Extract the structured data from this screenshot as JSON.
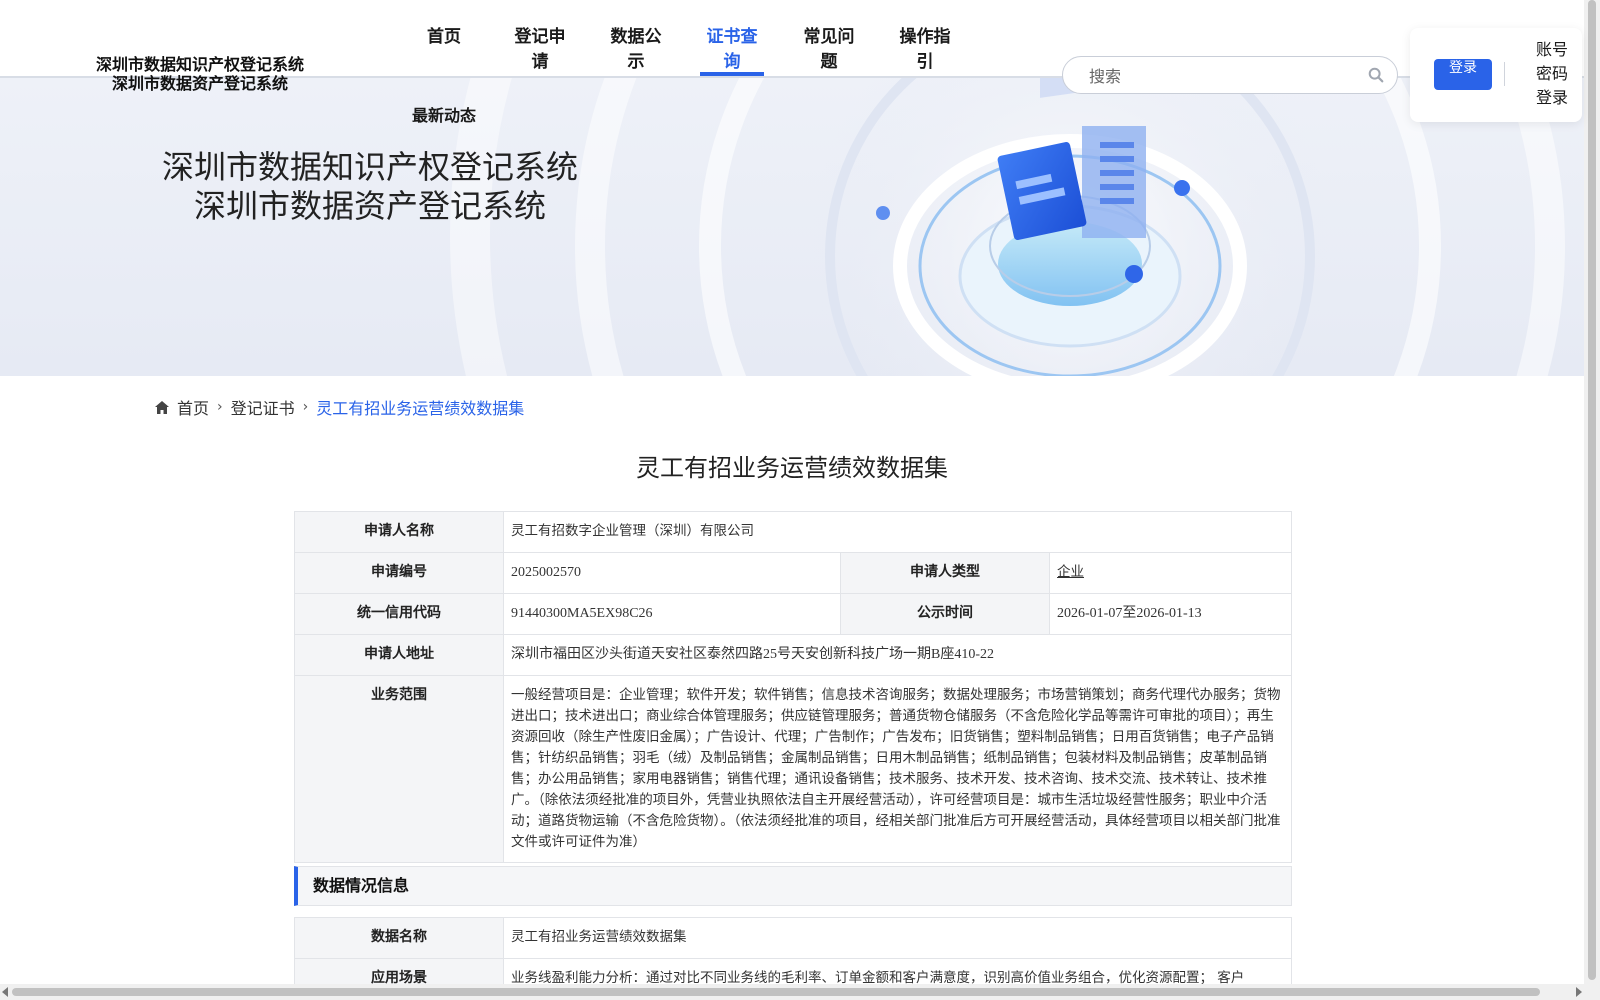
{
  "header": {
    "brand_line1": "深圳市数据知识产权登记系统",
    "brand_line2": "深圳市数据资产登记系统",
    "nav": [
      {
        "label": "首页",
        "active": false
      },
      {
        "label": "登记申请",
        "active": false
      },
      {
        "label": "数据公示",
        "active": false
      },
      {
        "label": "证书查询",
        "active": true
      },
      {
        "label": "常见问题",
        "active": false
      },
      {
        "label": "操作指引",
        "active": false
      }
    ],
    "nav_extra": "最新动态",
    "search_placeholder": "搜索",
    "search_icon": "search-icon",
    "login_button": "登录",
    "account_links": [
      "账号",
      "密码",
      "登录"
    ],
    "accent_color": "#2a63e8"
  },
  "banner": {
    "title_line1": "深圳市数据知识产权登记系统",
    "title_line2": "深圳市数据资产登记系统"
  },
  "breadcrumb": {
    "home_icon": "home-icon",
    "home": "首页",
    "level2": "登记证书",
    "current": "灵工有招业务运营绩效数据集"
  },
  "page_title": "灵工有招业务运营绩效数据集",
  "applicant": {
    "name_label": "申请人名称",
    "name_value": "灵工有招数字企业管理（深圳）有限公司",
    "app_no_label": "申请编号",
    "app_no_value": "2025002570",
    "type_label": "申请人类型",
    "type_value": "企业",
    "credit_label": "统一信用代码",
    "credit_value": "91440300MA5EX98C26",
    "period_label": "公示时间",
    "period_value": "2026-01-07至2026-01-13",
    "address_label": "申请人地址",
    "address_value": "深圳市福田区沙头街道天安社区泰然四路25号天安创新科技广场一期B座410-22",
    "scope_label": "业务范围",
    "scope_value": "一般经营项目是：企业管理；软件开发；软件销售；信息技术咨询服务；数据处理服务；市场营销策划；商务代理代办服务；货物进出口；技术进出口；商业综合体管理服务；供应链管理服务；普通货物仓储服务（不含危险化学品等需许可审批的项目）；再生资源回收（除生产性废旧金属）；广告设计、代理；广告制作；广告发布；旧货销售；塑料制品销售；日用百货销售；电子产品销售；针纺织品销售；羽毛（绒）及制品销售；金属制品销售；日用木制品销售；纸制品销售；包装材料及制品销售；皮革制品销售；办公用品销售；家用电器销售；销售代理；通讯设备销售；技术服务、技术开发、技术咨询、技术交流、技术转让、技术推广。（除依法须经批准的项目外，凭营业执照依法自主开展经营活动），许可经营项目是：城市生活垃圾经营性服务；职业中介活动；道路货物运输（不含危险货物）。（依法须经批准的项目，经相关部门批准后方可开展经营活动，具体经营项目以相关部门批准文件或许可证件为准）"
  },
  "data_section": {
    "heading": "数据情况信息",
    "name_label": "数据名称",
    "name_value": "灵工有招业务运营绩效数据集",
    "scene_label": "应用场景",
    "scene_value": "业务线盈利能力分析：通过对比不同业务线的毛利率、订单金额和客户满意度，识别高价值业务组合，优化资源配置； 客户"
  }
}
